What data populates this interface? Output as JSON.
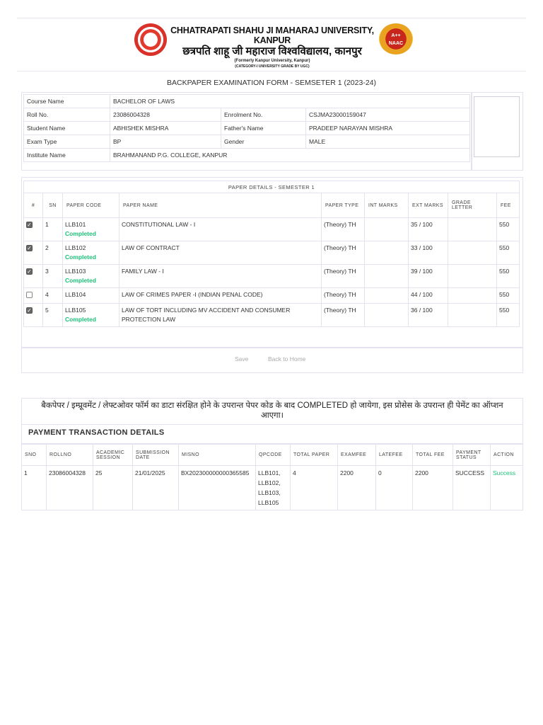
{
  "header": {
    "university_en": "CHHATRAPATI SHAHU JI MAHARAJ UNIVERSITY, KANPUR",
    "university_hi": "छत्रपति शाहू जी महाराज विश्वविद्यालय, कानपुर",
    "formerly": "(Formerly Kanpur University, Kanpur)",
    "category": "(CATEGORY-I UNIVERSITY GRADE BY UGC)",
    "naac_grade": "A++",
    "naac_label": "NAAC"
  },
  "form_title": "BACKPAPER EXAMINATION FORM - SEMSETER 1 (2023-24)",
  "student": {
    "course_label": "Course Name",
    "course": "BACHELOR OF LAWS",
    "roll_label": "Roll No.",
    "roll": "23086004328",
    "enrol_label": "Enrolment No.",
    "enrol": "CSJMA23000159047",
    "name_label": "Student Name",
    "name": "ABHISHEK MISHRA",
    "father_label": "Father's Name",
    "father": "PRADEEP NARAYAN MISHRA",
    "exam_type_label": "Exam Type",
    "exam_type": "BP",
    "gender_label": "Gender",
    "gender": "MALE",
    "institute_label": "Institute Name",
    "institute": "BRAHMANAND P.G. COLLEGE, KANPUR"
  },
  "papers": {
    "title": "PAPER DETAILS - SEMESTER 1",
    "headers": [
      "#",
      "SN",
      "PAPER CODE",
      "PAPER NAME",
      "PAPER TYPE",
      "INT MARKS",
      "EXT MARKS",
      "GRADE LETTER",
      "FEE"
    ],
    "rows": [
      {
        "checked": true,
        "sn": "1",
        "code": "LLB101",
        "status": "Completed",
        "name": "CONSTITUTIONAL LAW - I",
        "type": "(Theory) TH",
        "int": "",
        "ext": "35 / 100",
        "grade": "",
        "fee": "550"
      },
      {
        "checked": true,
        "sn": "2",
        "code": "LLB102",
        "status": "Completed",
        "name": "LAW OF CONTRACT",
        "type": "(Theory) TH",
        "int": "",
        "ext": "33 / 100",
        "grade": "",
        "fee": "550"
      },
      {
        "checked": true,
        "sn": "3",
        "code": "LLB103",
        "status": "Completed",
        "name": "FAMILY LAW - I",
        "type": "(Theory) TH",
        "int": "",
        "ext": "39 / 100",
        "grade": "",
        "fee": "550"
      },
      {
        "checked": false,
        "sn": "4",
        "code": "LLB104",
        "status": "",
        "name": "LAW OF CRIMES PAPER -I (INDIAN PENAL CODE)",
        "type": "(Theory) TH",
        "int": "",
        "ext": "44 / 100",
        "grade": "",
        "fee": "550"
      },
      {
        "checked": true,
        "sn": "5",
        "code": "LLB105",
        "status": "Completed",
        "name": "LAW OF TORT INCLUDING MV ACCIDENT AND CONSUMER PROTECTION LAW",
        "type": "(Theory) TH",
        "int": "",
        "ext": "36 / 100",
        "grade": "",
        "fee": "550"
      }
    ],
    "save_label": "Save",
    "back_label": "Back to Home"
  },
  "notice": "बैकपेपर / इम्प्रूवमेंट / लेफ्टओवर फॉर्म का डाटा संरक्षित होने के उपरान्त पेपर कोड के बाद COMPLETED हो जायेगा, इस प्रोसेस के उपरान्त ही पेमेंट का ऑप्शन आएगा।",
  "payment": {
    "title": "PAYMENT TRANSACTION DETAILS",
    "headers": [
      "SNO",
      "ROLLNO",
      "ACADEMIC SESSION",
      "SUBMISSION DATE",
      "MISNO",
      "QPCODE",
      "TOTAL PAPER",
      "EXAMFEE",
      "LATEFEE",
      "TOTAL FEE",
      "PAYMENT STATUS",
      "ACTION"
    ],
    "rows": [
      [
        "1",
        "23086004328",
        "25",
        "21/01/2025",
        "BX202300000000365585",
        "LLB101, LLB102, LLB103, LLB105",
        "4",
        "2200",
        "0",
        "2200",
        "SUCCESS",
        "Success"
      ]
    ]
  },
  "colors": {
    "completed": "#1ec37a",
    "border": "#e3e3ef"
  }
}
